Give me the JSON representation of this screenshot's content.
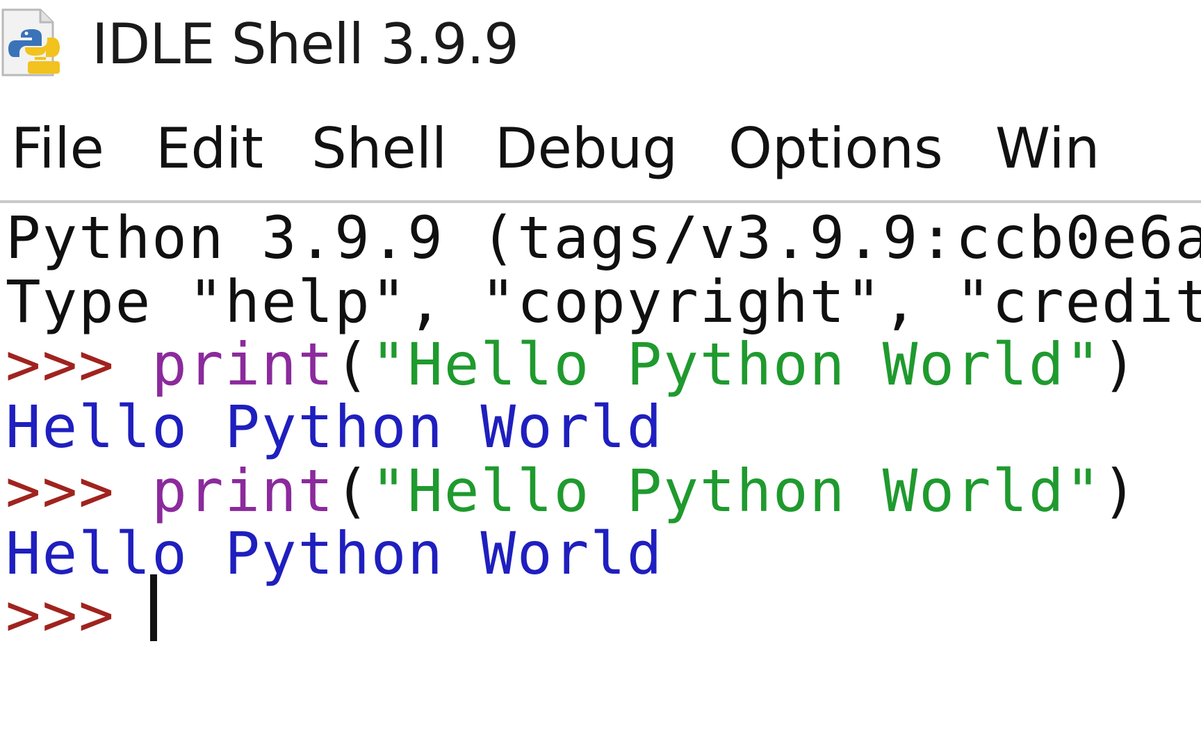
{
  "window": {
    "title": "IDLE Shell 3.9.9",
    "icon": "python-idle-icon"
  },
  "menu": {
    "items": [
      "File",
      "Edit",
      "Shell",
      "Debug",
      "Options",
      "Win"
    ]
  },
  "shell": {
    "banner_line1": "Python 3.9.9 (tags/v3.9.9:ccb0e6a",
    "banner_line2": "Type \"help\", \"copyright\", \"credit",
    "history": [
      {
        "prompt": ">>>",
        "func": "print",
        "open_paren": "(",
        "string": "\"Hello Python World\"",
        "close_paren": ")",
        "output": "Hello Python World"
      },
      {
        "prompt": ">>>",
        "func": "print",
        "open_paren": "(",
        "string": "\"Hello Python World\"",
        "close_paren": ")",
        "output": "Hello Python World"
      }
    ],
    "current_prompt": ">>>"
  },
  "colors": {
    "prompt": "#a0231f",
    "builtin": "#8b2a9c",
    "string": "#1f9a2e",
    "output": "#1f1fbf",
    "stdout": "#101010"
  }
}
